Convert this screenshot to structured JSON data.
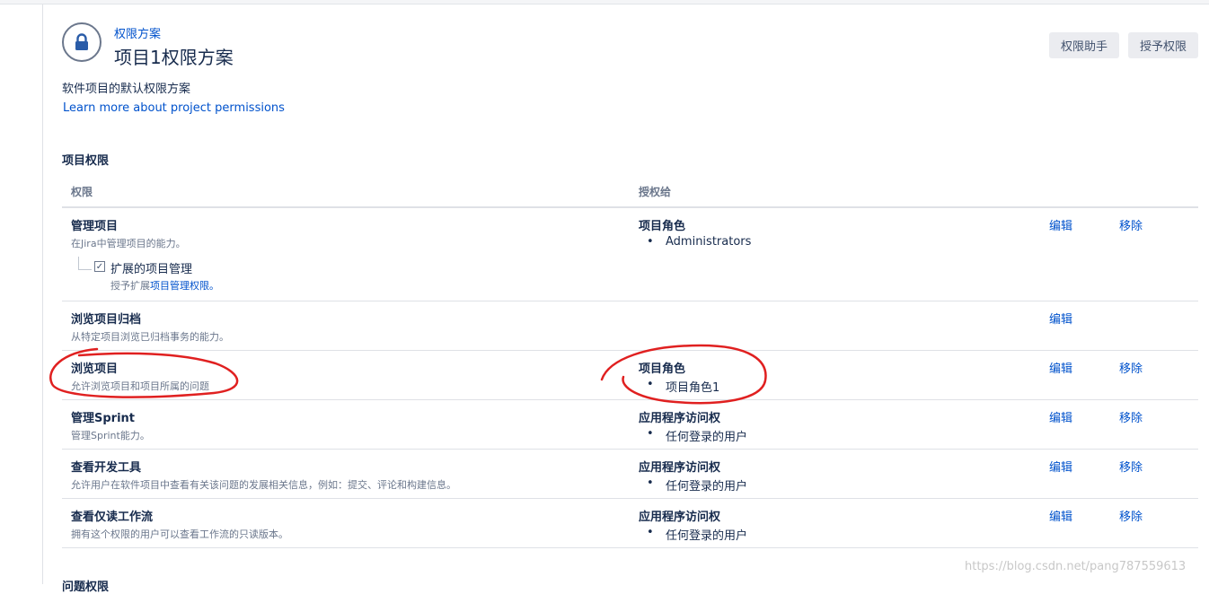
{
  "header": {
    "breadcrumb": "权限方案",
    "title": "项目1权限方案",
    "buttons": {
      "helper": "权限助手",
      "grant": "授予权限"
    }
  },
  "description": "软件项目的默认权限方案",
  "learn_more": "Learn more about project permissions",
  "section": {
    "title": "项目权限",
    "columns": {
      "permission": "权限",
      "granted_to": "授权给"
    }
  },
  "rows": [
    {
      "name": "管理项目",
      "desc": "在Jira中管理项目的能力。",
      "grant_type": "项目角色",
      "grant_item": "Administrators",
      "edit": "编辑",
      "remove": "移除",
      "sub": {
        "label": "扩展的项目管理",
        "desc_prefix": "授予扩展",
        "desc_link": "项目管理权限。",
        "checked_glyph": "✓"
      }
    },
    {
      "name": "浏览项目归档",
      "desc": "从特定项目浏览已归档事务的能力。",
      "edit": "编辑"
    },
    {
      "name": "浏览项目",
      "desc": "允许浏览项目和项目所属的问题",
      "grant_type": "项目角色",
      "grant_item": "项目角色1",
      "edit": "编辑",
      "remove": "移除"
    },
    {
      "name": "管理Sprint",
      "desc": "管理Sprint能力。",
      "grant_type": "应用程序访问权",
      "grant_item": "任何登录的用户",
      "edit": "编辑",
      "remove": "移除"
    },
    {
      "name": "查看开发工具",
      "desc": "允许用户在软件项目中查看有关该问题的发展相关信息，例如：提交、评论和构建信息。",
      "grant_type": "应用程序访问权",
      "grant_item": "任何登录的用户",
      "edit": "编辑",
      "remove": "移除"
    },
    {
      "name": "查看仅读工作流",
      "desc": "拥有这个权限的用户可以查看工作流的只读版本。",
      "grant_type": "应用程序访问权",
      "grant_item": "任何登录的用户",
      "edit": "编辑",
      "remove": "移除"
    }
  ],
  "next_section_title": "问题权限",
  "watermark": "https://blog.csdn.net/pang787559613",
  "colors": {
    "link": "#0052cc",
    "text": "#172b4d",
    "muted": "#6b778c",
    "annotation": "#e02020"
  },
  "icons": {
    "scheme": "lock-icon"
  }
}
